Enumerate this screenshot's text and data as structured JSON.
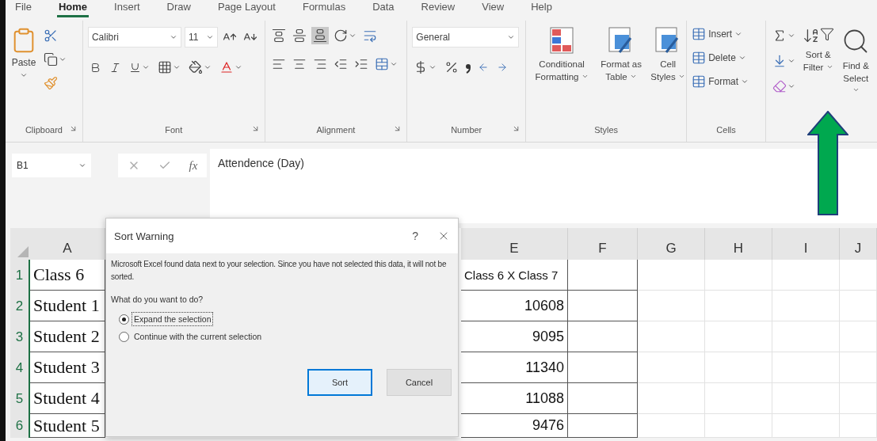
{
  "ribbon_tabs": [
    {
      "label": "File",
      "selected": false
    },
    {
      "label": "Home",
      "selected": true
    },
    {
      "label": "Insert",
      "selected": false
    },
    {
      "label": "Draw",
      "selected": false
    },
    {
      "label": "Page Layout",
      "selected": false
    },
    {
      "label": "Formulas",
      "selected": false
    },
    {
      "label": "Data",
      "selected": false
    },
    {
      "label": "Review",
      "selected": false
    },
    {
      "label": "View",
      "selected": false
    },
    {
      "label": "Help",
      "selected": false
    }
  ],
  "ribbon": {
    "clipboard": {
      "paste_label": "Paste",
      "group_label": "Clipboard"
    },
    "font": {
      "font_name": "Calibri",
      "font_size": "11",
      "group_label": "Font"
    },
    "alignment": {
      "group_label": "Alignment"
    },
    "number": {
      "format": "General",
      "group_label": "Number"
    },
    "styles": {
      "buttons": [
        "Conditional Formatting",
        "Format as Table",
        "Cell Styles"
      ],
      "group_label": "Styles"
    },
    "cells": {
      "buttons": [
        "Insert",
        "Delete",
        "Format"
      ],
      "group_label": "Cells"
    },
    "editing": {
      "buttons": [
        "Sort & Filter",
        "Find & Select"
      ]
    }
  },
  "formula_bar": {
    "name_box": "B1",
    "fx": "fx",
    "formula": "Attendence (Day)"
  },
  "sheet": {
    "columns": [
      "A",
      "E",
      "F",
      "G",
      "H",
      "I",
      "J"
    ],
    "rows": [
      {
        "number": "1",
        "column_a": "Class 6",
        "column_e": "Class 6 X Class 7",
        "kind": "text"
      },
      {
        "number": "2",
        "column_a": "Student 1",
        "column_e": "10608",
        "kind": "number"
      },
      {
        "number": "3",
        "column_a": "Student 2",
        "column_e": "9095",
        "kind": "number"
      },
      {
        "number": "4",
        "column_a": "Student 3",
        "column_e": "11340",
        "kind": "number"
      },
      {
        "number": "5",
        "column_a": "Student 4",
        "column_e": "11088",
        "kind": "number"
      },
      {
        "number": "6",
        "column_a": "Student 5",
        "column_e": "9476",
        "kind": "number"
      }
    ]
  },
  "dialog": {
    "title": "Sort Warning",
    "help": "?",
    "message": "Microsoft Excel found data next to your selection.  Since you have not selected this data, it will not be sorted.",
    "question": "What do you want to do?",
    "options": [
      {
        "label": "Expand the selection",
        "selected": true
      },
      {
        "label": "Continue with the current selection",
        "selected": false
      }
    ],
    "buttons": [
      {
        "label": "Sort",
        "kind": "default"
      },
      {
        "label": "Cancel",
        "kind": "normal"
      }
    ]
  }
}
